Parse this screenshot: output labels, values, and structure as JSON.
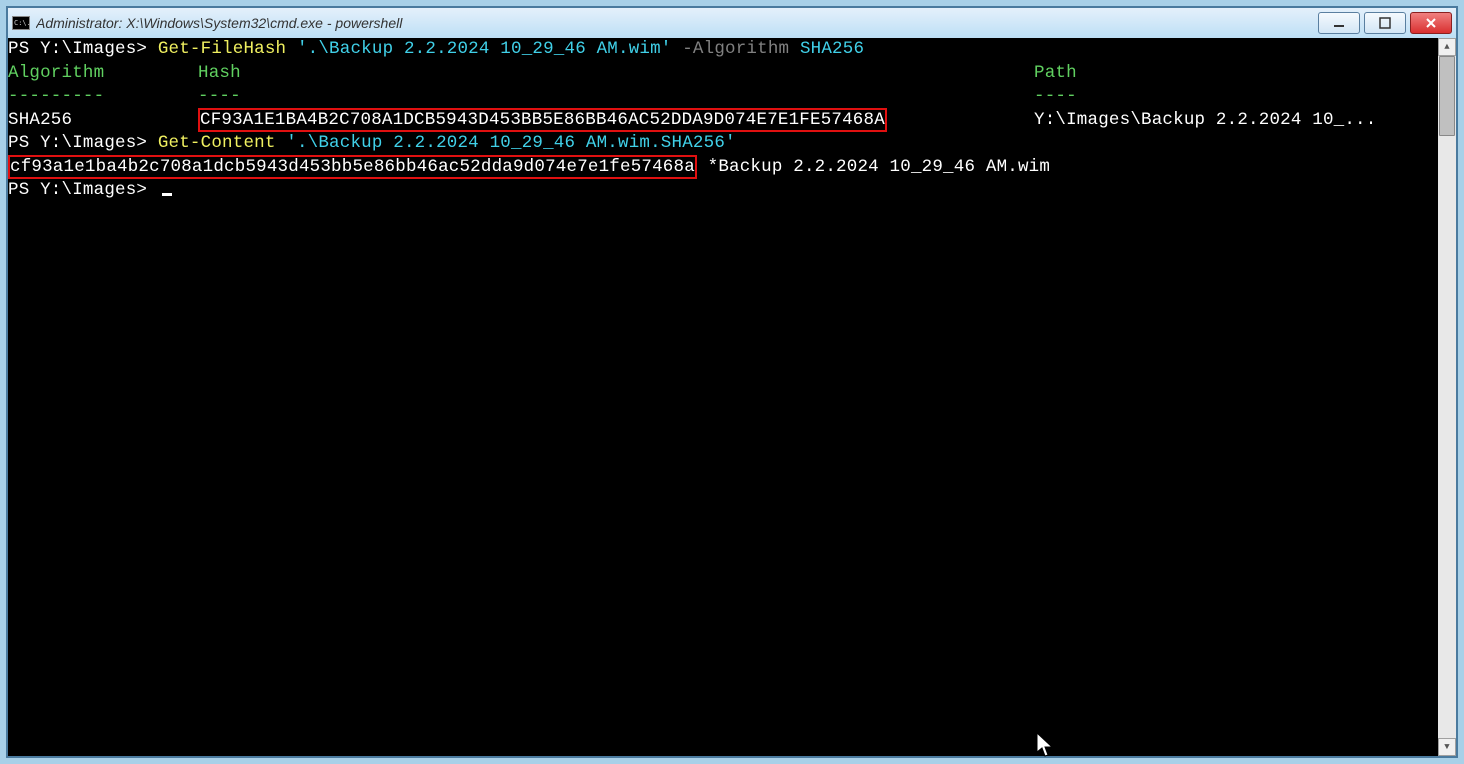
{
  "window": {
    "title": "Administrator: X:\\Windows\\System32\\cmd.exe - powershell",
    "icon_text": "C:\\."
  },
  "cmd1": {
    "prompt": "PS Y:\\Images> ",
    "cmdlet": "Get-FileHash ",
    "arg": "'.\\Backup 2.2.2024 10_29_46 AM.wim'",
    "param": " -Algorithm ",
    "paramval": "SHA256"
  },
  "blank": "",
  "headers": {
    "algorithm": "Algorithm",
    "hash": "Hash",
    "path": "Path"
  },
  "dashes": {
    "algorithm": "---------",
    "hash": "----",
    "path": "----"
  },
  "row": {
    "algorithm": "SHA256",
    "hash": "CF93A1E1BA4B2C708A1DCB5943D453BB5E86BB46AC52DDA9D074E7E1FE57468A",
    "path": "Y:\\Images\\Backup 2.2.2024 10_..."
  },
  "cmd2": {
    "prompt": "PS Y:\\Images> ",
    "cmdlet": "Get-Content ",
    "arg": "'.\\Backup 2.2.2024 10_29_46 AM.wim.SHA256'"
  },
  "output2": {
    "hash": "cf93a1e1ba4b2c708a1dcb5943d453bb5e86bb46ac52dda9d074e7e1fe57468a",
    "rest": " *Backup 2.2.2024 10_29_46 AM.wim"
  },
  "prompt3": "PS Y:\\Images> "
}
